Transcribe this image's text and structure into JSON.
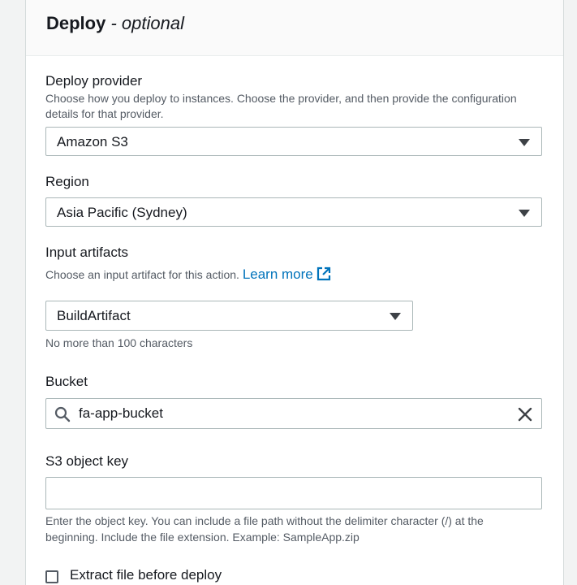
{
  "section": {
    "title": "Deploy",
    "title_suffix": " - optional"
  },
  "deploy_provider": {
    "label": "Deploy provider",
    "description": "Choose how you deploy to instances. Choose the provider, and then provide the configuration details for that provider.",
    "value": "Amazon S3"
  },
  "region": {
    "label": "Region",
    "value": "Asia Pacific (Sydney)"
  },
  "input_artifacts": {
    "label": "Input artifacts",
    "description": "Choose an input artifact for this action.",
    "learn_more": "Learn more",
    "value": "BuildArtifact",
    "constraint": "No more than 100 characters"
  },
  "bucket": {
    "label": "Bucket",
    "value": "fa-app-bucket"
  },
  "s3_object_key": {
    "label": "S3 object key",
    "value": "",
    "description_line1": "Enter the object key. You can include a file path without the delimiter character (/) at the",
    "description_line2": "beginning. Include the file extension. Example: SampleApp.zip"
  },
  "extract": {
    "label": "Extract file before deploy"
  },
  "colors": {
    "link": "#0073bb",
    "border": "#aab7b8",
    "text": "#16191f",
    "secondary_text": "#545b64"
  },
  "icons": {
    "dropdown": "caret-down-icon",
    "external": "external-link-icon",
    "search": "search-icon",
    "clear": "close-icon"
  }
}
